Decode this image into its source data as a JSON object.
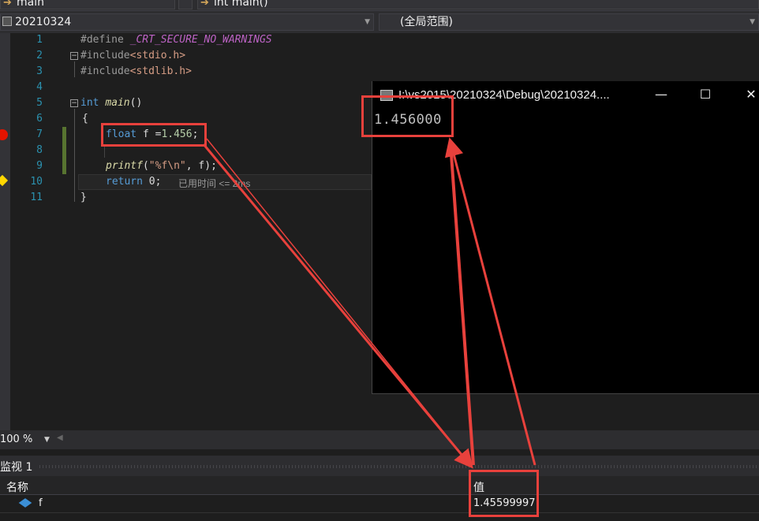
{
  "nav": {
    "top_left": "main",
    "top_right": "int main()",
    "project_combo": "20210324",
    "scope_combo": "(全局范围)"
  },
  "editor": {
    "line_numbers": [
      "1",
      "2",
      "3",
      "4",
      "5",
      "6",
      "7",
      "8",
      "9",
      "10",
      "11"
    ],
    "lines": {
      "l1_define": "#define ",
      "l1_macro": "_CRT_SECURE_NO_WARNINGS",
      "l2_include": "#include",
      "l2_header": "<stdio.h>",
      "l3_include": "#include",
      "l3_header": "<stdlib.h>",
      "l5_int": "int ",
      "l5_main": "main",
      "l5_parens": "()",
      "l6_brace": "{",
      "l7_float": "float",
      "l7_rest": " f =",
      "l7_num": "1.456",
      "l7_semi": ";",
      "l9_printf": "printf",
      "l9_open": "(",
      "l9_str": "\"%f\\n\"",
      "l9_rest": ", f);",
      "l10_return": "return",
      "l10_zero": " 0;",
      "l10_hint": "已用时间 <= 2ms",
      "l11_brace": "}"
    }
  },
  "console": {
    "title": "I:\\vs2015\\20210324\\Debug\\20210324....",
    "output": "1.456000",
    "minimize": "—",
    "maximize": "☐",
    "close": "✕"
  },
  "zoom": {
    "value": "100 %"
  },
  "watch": {
    "title": "监视 1",
    "col_name": "名称",
    "col_value": "值",
    "rows": [
      {
        "name": "f",
        "value": "1.45599997"
      }
    ]
  },
  "colors": {
    "annotation": "#e8413c",
    "breakpoint": "#e51400"
  }
}
